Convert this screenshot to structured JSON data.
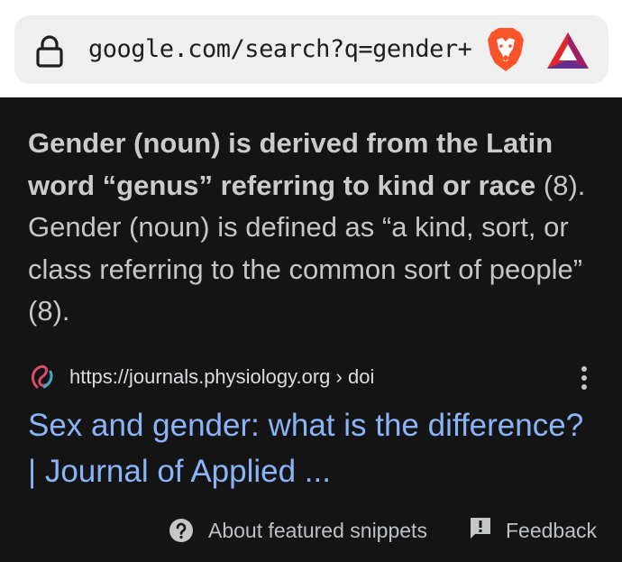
{
  "browser": {
    "url": "google.com/search?q=gender+ca",
    "brave_icon": "brave-lion-icon",
    "rewards_icon": "bat-triangle-icon"
  },
  "snippet": {
    "bold_text": "Gender (noun) is derived from the Latin word “genus” referring to kind or race",
    "plain_text": " (8). Gender (noun) is defined as “a kind, sort, or class referring to the common sort of people” (8)."
  },
  "source": {
    "url": "https://journals.physiology.org › doi",
    "title": "Sex and gender: what is the difference? | Journal of Applied ..."
  },
  "footer": {
    "about_label": "About featured snippets",
    "feedback_label": "Feedback"
  },
  "colors": {
    "background": "#141414",
    "link": "#8ab4f8",
    "text": "#c4c7c5"
  }
}
